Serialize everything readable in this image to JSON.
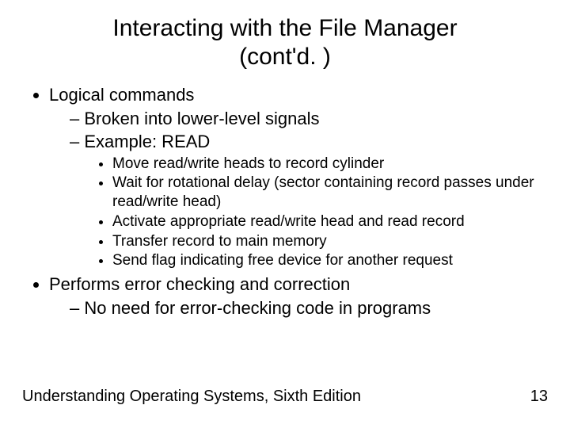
{
  "title_line1": "Interacting with the File Manager",
  "title_line2": "(cont'd. )",
  "b1": "Logical commands",
  "b1_s1": "Broken into lower-level signals",
  "b1_s2": "Example: READ",
  "b1_s2_d1": "Move read/write heads to record cylinder",
  "b1_s2_d2": "Wait for rotational delay (sector containing record passes under read/write head)",
  "b1_s2_d3": "Activate appropriate read/write head and read record",
  "b1_s2_d4": "Transfer record to main memory",
  "b1_s2_d5": "Send flag indicating free device for another request",
  "b2": "Performs error checking and correction",
  "b2_s1": "No need for error-checking code in programs",
  "footer_text": "Understanding Operating Systems, Sixth Edition",
  "page_number": "13"
}
